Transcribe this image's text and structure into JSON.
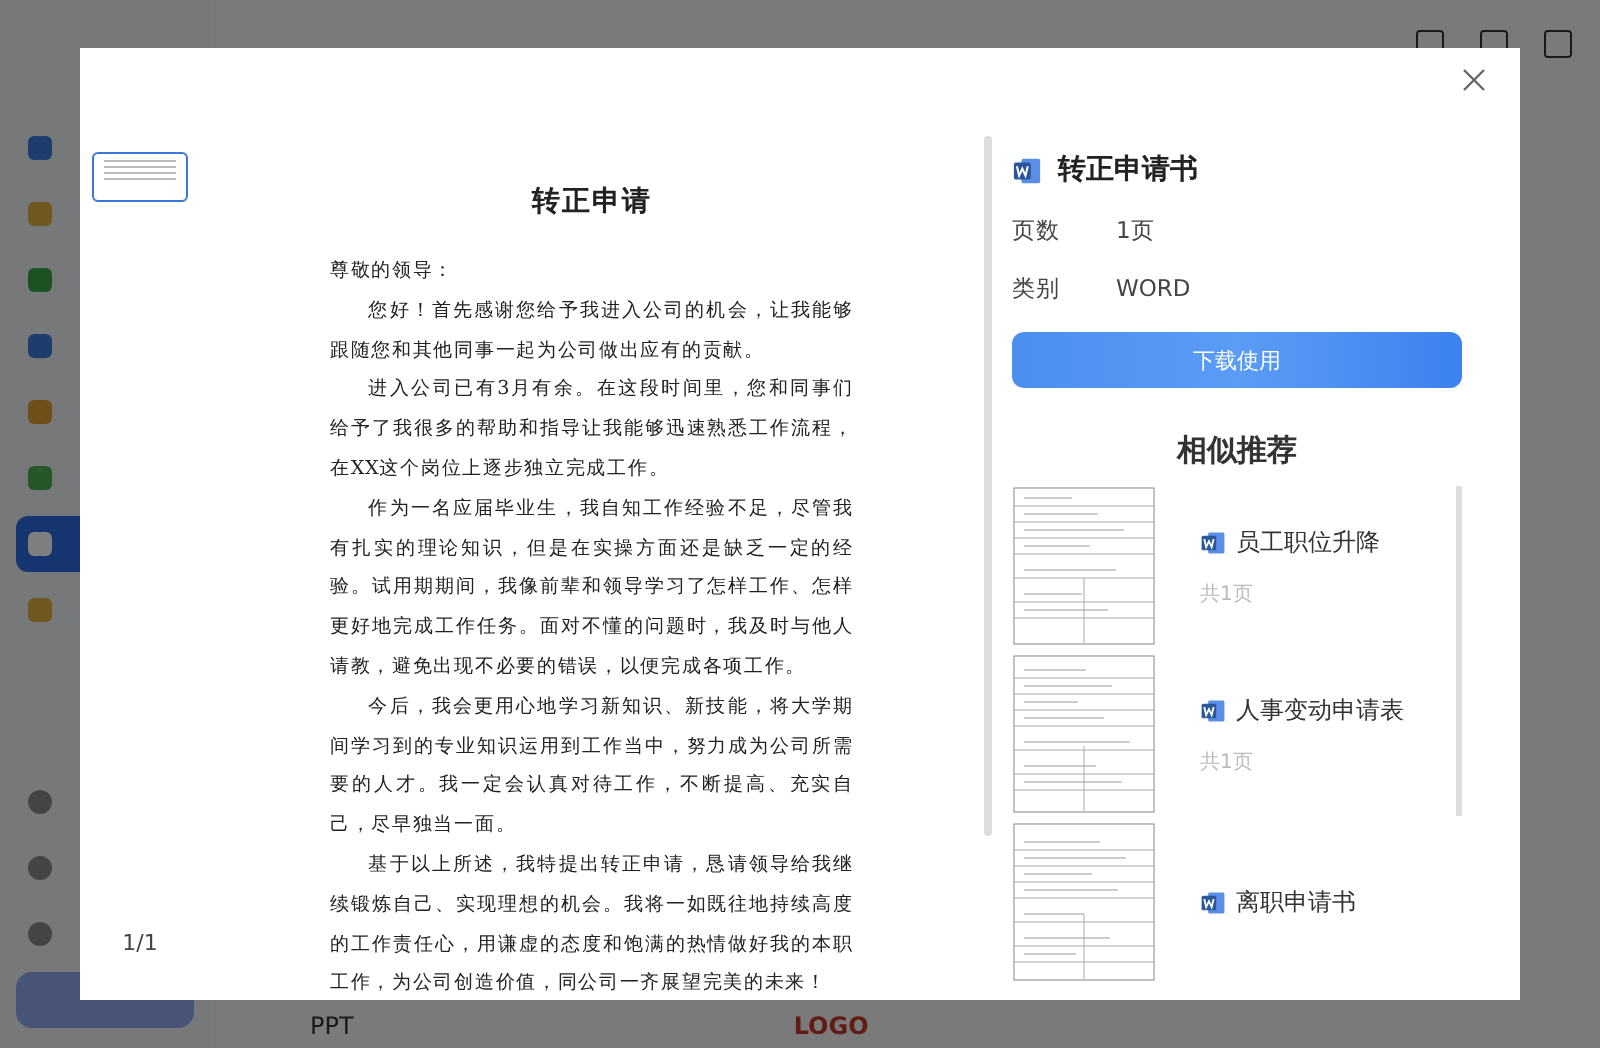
{
  "background_app": {
    "bottom_bar_label": "PPT",
    "footer_logo": "LOGO"
  },
  "preview": {
    "pages": [
      {
        "selected": true
      }
    ],
    "page_counter": "1/1",
    "document": {
      "title": "转正申请",
      "paragraphs": [
        {
          "text": "尊敬的领导：",
          "indent": false
        },
        {
          "text": "您好！首先感谢您给予我进入公司的机会，让我能够跟随您和其他同事一起为公司做出应有的贡献。",
          "indent": true
        },
        {
          "text": "进入公司已有3月有余。在这段时间里，您和同事们给予了我很多的帮助和指导让我能够迅速熟悉工作流程，在XX这个岗位上逐步独立完成工作。",
          "indent": true
        },
        {
          "text": "作为一名应届毕业生，我自知工作经验不足，尽管我有扎实的理论知识，但是在实操方面还是缺乏一定的经验。试用期期间，我像前辈和领导学习了怎样工作、怎样更好地完成工作任务。面对不懂的问题时，我及时与他人请教，避免出现不必要的错误，以便完成各项工作。",
          "indent": true
        },
        {
          "text": "今后，我会更用心地学习新知识、新技能，将大学期间学习到的专业知识运用到工作当中，努力成为公司所需要的人才。我一定会认真对待工作，不断提高、充实自己，尽早独当一面。",
          "indent": true
        },
        {
          "text": "基于以上所述，我特提出转正申请，恳请领导给我继续锻炼自己、实现理想的机会。我将一如既往地持续高度的工作责任心，用谦虚的态度和饱满的热情做好我的本职工作，为公司创造价值，同公司一齐展望完美的未来！",
          "indent": true
        }
      ]
    }
  },
  "details": {
    "title": "转正申请书",
    "meta": [
      {
        "label": "页数",
        "value": "1页"
      },
      {
        "label": "类别",
        "value": "WORD"
      }
    ],
    "download_button": "下载使用",
    "similar_heading": "相似推荐",
    "similar": [
      {
        "title": "员工职位升降",
        "pages": "共1页"
      },
      {
        "title": "人事变动申请表",
        "pages": "共1页"
      },
      {
        "title": "离职申请书"
      }
    ]
  }
}
